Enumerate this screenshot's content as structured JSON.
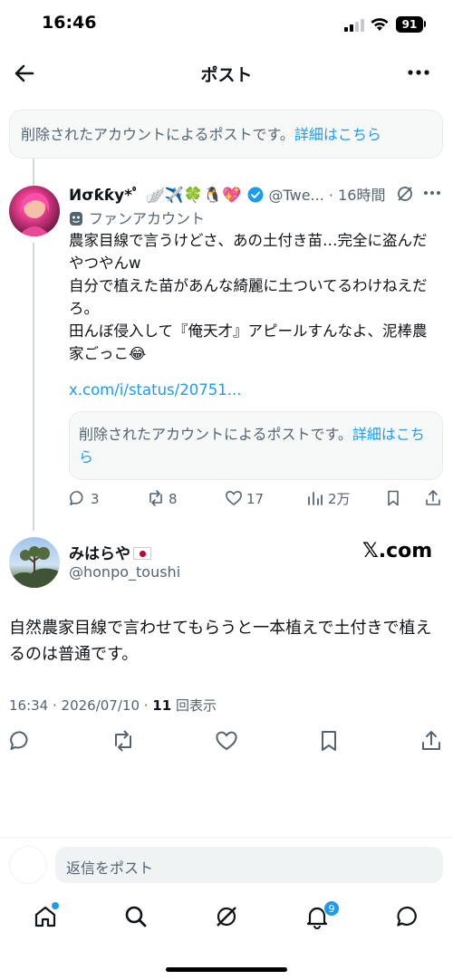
{
  "status_bar": {
    "time": "16:46",
    "battery": "91"
  },
  "header": {
    "title": "ポスト"
  },
  "deleted_notice": {
    "text": "削除されたアカウントによるポストです。",
    "link": "詳細はこちら"
  },
  "quoted_post": {
    "author_name": "Иσƙƙу*ﾟ 🪽✈️🍀🐧💖",
    "handle": "@Twe...",
    "time": "16時間",
    "label": "ファンアカウント",
    "body_lines": [
      "農家目線で言うけどさ、あの土付き苗…完全に盗んだやつやんw",
      "自分で植えた苗があんな綺麗に土ついてるわけねえだろ。",
      "田んぼ侵入して『俺天才』アピールすんなよ、泥棒農家ごっこ😂"
    ],
    "link": "x.com/i/status/20751...",
    "quoted_deleted": {
      "text": "削除されたアカウントによるポストです。",
      "link": "詳細はこちら"
    },
    "actions": {
      "replies": "3",
      "reposts": "8",
      "likes": "17",
      "views": "2万"
    }
  },
  "main_post": {
    "author_name": "みはらや",
    "handle": "@honpo_toushi",
    "source_badge": "𝕏.com",
    "text": "自然農家目線で言わせてもらうと一本植えで土付きで植えるのは普通です。",
    "time": "16:34 · 2026/07/10 · ",
    "views_count": "11",
    "views_label": " 回表示"
  },
  "reply_bar": {
    "placeholder": "返信をポスト"
  },
  "tabbar": {
    "notifications_badge": "9"
  },
  "colors": {
    "accent": "#1d9bf0",
    "text": "#0f1419",
    "secondary": "#536471"
  }
}
